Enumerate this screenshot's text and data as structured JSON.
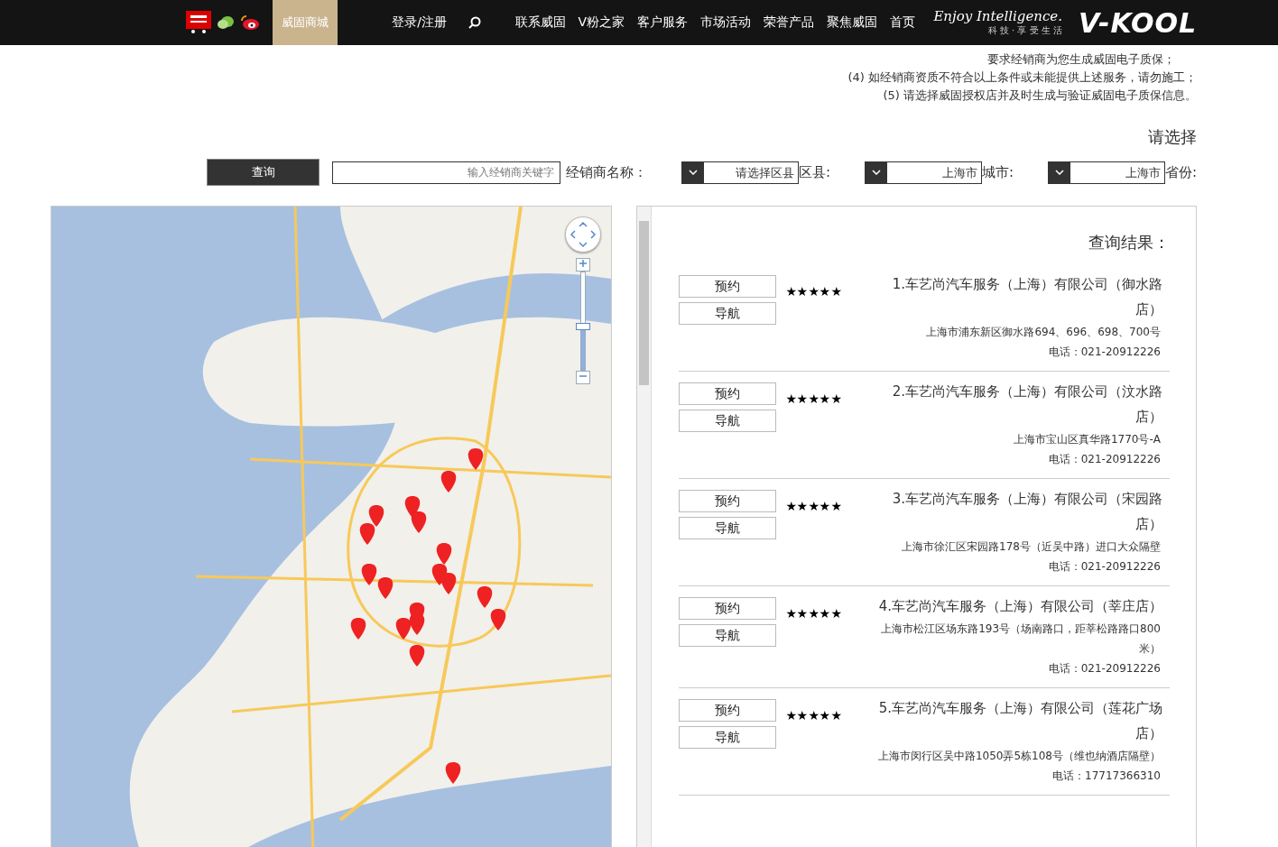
{
  "nav": {
    "logo": "V-KOOL",
    "slogan": "Enjoy Intelligence.",
    "tagline": "科 技 · 享 受 生 活",
    "menu": [
      {
        "label": "联系威固"
      },
      {
        "label": "V粉之家"
      },
      {
        "label": "客户服务"
      },
      {
        "label": "市场活动"
      },
      {
        "label": "荣誉产品"
      },
      {
        "label": "聚焦威固"
      },
      {
        "label": "首页"
      }
    ],
    "login": "登录/注册",
    "shop": {
      "label": "威固商城",
      "selected": true
    }
  },
  "notes": [
    "要求经销商为您生成威固电子质保；",
    "(4) 如经销商资质不符合以上条件或未能提供上述服务，请勿施工；",
    "(5) 请选择威固授权店并及时生成与验证威固电子质保信息。"
  ],
  "section_title": "请选择",
  "filters": {
    "province": {
      "label": "省份:",
      "value": "上海市"
    },
    "city": {
      "label": "城市:",
      "value": "上海市"
    },
    "district": {
      "label": "区县:",
      "value": "请选择区县"
    },
    "dealer": {
      "label": "经销商名称：",
      "placeholder": "输入经销商关键字"
    },
    "search_button": "查询"
  },
  "results": {
    "title": "查询结果：",
    "items": [
      {
        "name": "1.车艺尚汽车服务（上海）有限公司（御水路店）",
        "address": "上海市浦东新区御水路694、696、698、700号",
        "phone": "电话：021-20912226",
        "stars": 5,
        "buttons": [
          "预约",
          "导航"
        ]
      },
      {
        "name": "2.车艺尚汽车服务（上海）有限公司（汶水路店）",
        "address": "上海市宝山区真华路1770号-A",
        "phone": "电话：021-20912226",
        "stars": 5,
        "buttons": [
          "预约",
          "导航"
        ]
      },
      {
        "name": "3.车艺尚汽车服务（上海）有限公司（宋园路店）",
        "address": "上海市徐汇区宋园路178号（近吴中路）进口大众隔壁",
        "phone": "电话：021-20912226",
        "stars": 5,
        "buttons": [
          "预约",
          "导航"
        ]
      },
      {
        "name": "4.车艺尚汽车服务（上海）有限公司（莘庄店）",
        "address": "上海市松江区场东路193号（场南路口，距莘松路路口800米）",
        "phone": "电话：021-20912226",
        "stars": 5,
        "buttons": [
          "预约",
          "导航"
        ]
      },
      {
        "name": "5.车艺尚汽车服务（上海）有限公司（莲花广场店）",
        "address": "上海市闵行区吴中路1050弄5栋108号（维也纳酒店隔壁）",
        "phone": "电话：17717366310",
        "stars": 5,
        "buttons": [
          "预约",
          "导航"
        ]
      }
    ]
  },
  "map": {
    "kind": "picture",
    "zoom": {
      "level": 0.45
    }
  }
}
